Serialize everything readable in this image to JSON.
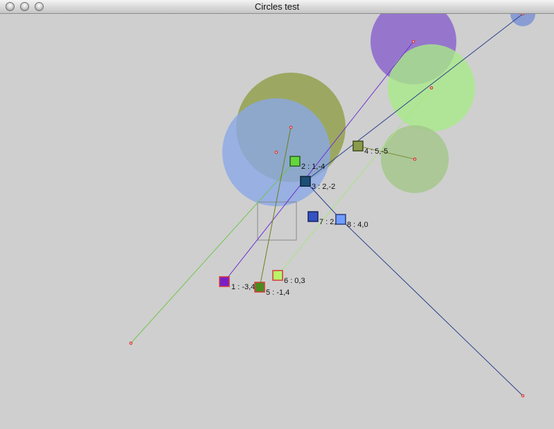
{
  "window": {
    "title": "Circles test"
  },
  "nodes": [
    {
      "label": "1 : -3,4",
      "color": "#7a1fc4",
      "border": "#d43a3a"
    },
    {
      "label": "2 : 1,-4",
      "color": "#63d63e",
      "border": "#2d5f24"
    },
    {
      "label": "3 : 2,-2",
      "color": "#1c4f78",
      "border": "#0e2236"
    },
    {
      "label": "4 : 5,-5",
      "color": "#8a9b4b",
      "border": "#3f4a22"
    },
    {
      "label": "5 : -1,4",
      "color": "#4c8a1f",
      "border": "#d43a3a"
    },
    {
      "label": "6 : 0,3",
      "color": "#b8f568",
      "border": "#d43a3a"
    },
    {
      "label": "7 : 2,0",
      "color": "#3552c4",
      "border": "#15225a"
    },
    {
      "label": "8 : 4,0",
      "color": "#6f9dff",
      "border": "#2d3a78"
    }
  ],
  "circle_colors": {
    "olive": "#8f9e45",
    "blue": "#8aa7e6",
    "purple": "#8c66cc",
    "green": "#a8ea88",
    "sage": "#a6c78d",
    "small_blue": "#7d93d4"
  },
  "accent": {
    "endpoint": "#d42b2b",
    "frame": "#888888"
  }
}
